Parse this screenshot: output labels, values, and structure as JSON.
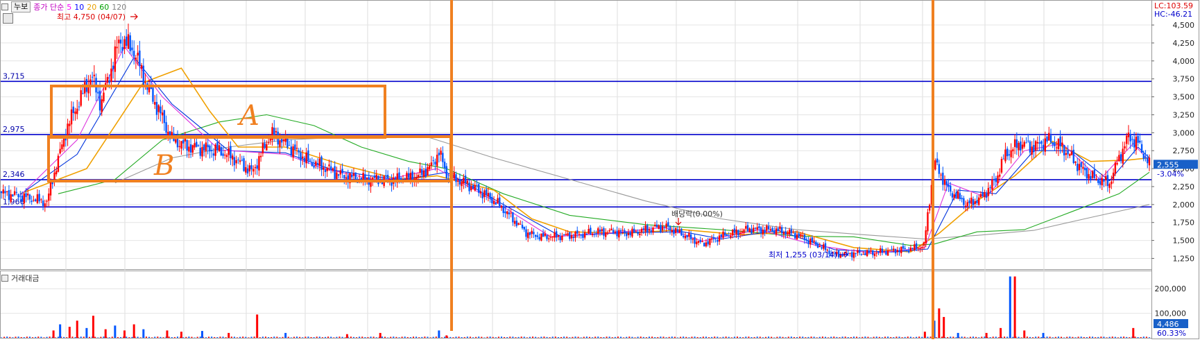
{
  "header": {
    "stock_name": "누보",
    "indicator_label": "종가 단순",
    "ma_periods": [
      {
        "label": "5",
        "color": "#ff00ff"
      },
      {
        "label": "10",
        "color": "#0000ff"
      },
      {
        "label": "20",
        "color": "#e8a000"
      },
      {
        "label": "60",
        "color": "#00a000"
      },
      {
        "label": "120",
        "color": "#808080"
      }
    ]
  },
  "right_info": {
    "lc": "LC:103.59",
    "hc": "HC:-46.21"
  },
  "price_axis": {
    "ticks": [
      "4,500",
      "4,250",
      "4,000",
      "3,750",
      "3,500",
      "3,250",
      "3,000",
      "2,750",
      "2,500",
      "2,250",
      "2,000",
      "1,750",
      "1,500",
      "1,250"
    ],
    "current_price": "2,555",
    "change_pct": "-3.04%"
  },
  "annotations": {
    "high": "최고 4,750 (04/07)",
    "low": "최저 1,255 (03/14)",
    "dividend": "배당락(0.00%)",
    "hand_a": "A",
    "hand_b": "B"
  },
  "levels": [
    {
      "label": "3,715",
      "price": 3715
    },
    {
      "label": "2,975",
      "price": 2975
    },
    {
      "label": "2,346",
      "price": 2346
    },
    {
      "label": "1,966",
      "price": 1966
    }
  ],
  "volume_panel": {
    "label": "거래대금",
    "ticks": [
      "200,000",
      "100,000"
    ],
    "current": "4,486",
    "pct": "60.33%"
  },
  "colors": {
    "up": "#ff0000",
    "down": "#0055ff",
    "level": "#0000cc",
    "marker": "#f08020"
  },
  "chart_data": {
    "type": "candlestick",
    "price_range": [
      1100,
      4800
    ],
    "volume_range": [
      0,
      260000
    ],
    "high": 4750,
    "low": 1255,
    "anchors": [
      [
        0,
        2160
      ],
      [
        20,
        2120
      ],
      [
        48,
        2030
      ],
      [
        55,
        2400
      ],
      [
        70,
        3100
      ],
      [
        95,
        3800
      ],
      [
        105,
        3400
      ],
      [
        125,
        4300
      ],
      [
        140,
        4150
      ],
      [
        155,
        3600
      ],
      [
        165,
        3350
      ],
      [
        180,
        2900
      ],
      [
        200,
        2800
      ],
      [
        215,
        2780
      ],
      [
        230,
        2750
      ],
      [
        245,
        2650
      ],
      [
        265,
        2450
      ],
      [
        285,
        3000
      ],
      [
        305,
        2800
      ],
      [
        325,
        2600
      ],
      [
        345,
        2500
      ],
      [
        360,
        2400
      ],
      [
        380,
        2350
      ],
      [
        400,
        2350
      ],
      [
        420,
        2350
      ],
      [
        440,
        2400
      ],
      [
        455,
        2550
      ],
      [
        462,
        2750
      ],
      [
        470,
        2400
      ],
      [
        490,
        2300
      ],
      [
        510,
        2150
      ],
      [
        525,
        2000
      ],
      [
        540,
        1800
      ],
      [
        555,
        1600
      ],
      [
        570,
        1550
      ],
      [
        590,
        1560
      ],
      [
        610,
        1580
      ],
      [
        630,
        1620
      ],
      [
        650,
        1620
      ],
      [
        665,
        1600
      ],
      [
        680,
        1650
      ],
      [
        700,
        1700
      ],
      [
        720,
        1580
      ],
      [
        740,
        1450
      ],
      [
        760,
        1560
      ],
      [
        790,
        1660
      ],
      [
        820,
        1640
      ],
      [
        840,
        1580
      ],
      [
        860,
        1450
      ],
      [
        880,
        1300
      ],
      [
        900,
        1320
      ],
      [
        920,
        1330
      ],
      [
        940,
        1360
      ],
      [
        960,
        1380
      ],
      [
        974,
        1430
      ],
      [
        985,
        2600
      ],
      [
        1000,
        2200
      ],
      [
        1020,
        2000
      ],
      [
        1035,
        2100
      ],
      [
        1050,
        2350
      ],
      [
        1060,
        2700
      ],
      [
        1075,
        2850
      ],
      [
        1090,
        2800
      ],
      [
        1105,
        2900
      ],
      [
        1120,
        2800
      ],
      [
        1140,
        2500
      ],
      [
        1155,
        2350
      ],
      [
        1170,
        2300
      ],
      [
        1180,
        2650
      ],
      [
        1190,
        2950
      ],
      [
        1200,
        2850
      ],
      [
        1212,
        2550
      ]
    ],
    "ma5": [
      [
        20,
        2130
      ],
      [
        80,
        2900
      ],
      [
        130,
        4200
      ],
      [
        170,
        3500
      ],
      [
        230,
        2760
      ],
      [
        300,
        2700
      ],
      [
        340,
        2500
      ],
      [
        400,
        2330
      ],
      [
        460,
        2500
      ],
      [
        520,
        2050
      ],
      [
        580,
        1550
      ],
      [
        650,
        1610
      ],
      [
        700,
        1680
      ],
      [
        740,
        1490
      ],
      [
        800,
        1650
      ],
      [
        860,
        1430
      ],
      [
        920,
        1320
      ],
      [
        975,
        1400
      ],
      [
        1000,
        2300
      ],
      [
        1040,
        2100
      ],
      [
        1080,
        2750
      ],
      [
        1120,
        2850
      ],
      [
        1160,
        2350
      ],
      [
        1195,
        2850
      ],
      [
        1212,
        2600
      ]
    ],
    "ma10": [
      [
        20,
        2140
      ],
      [
        80,
        2700
      ],
      [
        140,
        4050
      ],
      [
        180,
        3400
      ],
      [
        240,
        2750
      ],
      [
        300,
        2720
      ],
      [
        350,
        2480
      ],
      [
        420,
        2340
      ],
      [
        470,
        2450
      ],
      [
        530,
        2000
      ],
      [
        590,
        1560
      ],
      [
        660,
        1610
      ],
      [
        720,
        1620
      ],
      [
        760,
        1520
      ],
      [
        820,
        1640
      ],
      [
        880,
        1370
      ],
      [
        940,
        1340
      ],
      [
        978,
        1380
      ],
      [
        1010,
        2200
      ],
      [
        1050,
        2150
      ],
      [
        1090,
        2750
      ],
      [
        1130,
        2750
      ],
      [
        1170,
        2330
      ],
      [
        1200,
        2800
      ],
      [
        1212,
        2650
      ]
    ],
    "ma20": [
      [
        20,
        2150
      ],
      [
        90,
        2500
      ],
      [
        150,
        3700
      ],
      [
        190,
        3900
      ],
      [
        220,
        3300
      ],
      [
        250,
        2800
      ],
      [
        300,
        2800
      ],
      [
        360,
        2550
      ],
      [
        420,
        2350
      ],
      [
        460,
        2400
      ],
      [
        520,
        2200
      ],
      [
        560,
        1800
      ],
      [
        600,
        1620
      ],
      [
        660,
        1600
      ],
      [
        720,
        1650
      ],
      [
        780,
        1580
      ],
      [
        840,
        1620
      ],
      [
        900,
        1400
      ],
      [
        960,
        1340
      ],
      [
        990,
        1600
      ],
      [
        1030,
        2050
      ],
      [
        1070,
        2400
      ],
      [
        1110,
        2880
      ],
      [
        1150,
        2600
      ],
      [
        1190,
        2620
      ],
      [
        1212,
        2650
      ]
    ],
    "ma60": [
      [
        60,
        2150
      ],
      [
        120,
        2350
      ],
      [
        170,
        2900
      ],
      [
        230,
        3150
      ],
      [
        280,
        3250
      ],
      [
        330,
        3100
      ],
      [
        380,
        2800
      ],
      [
        430,
        2600
      ],
      [
        470,
        2500
      ],
      [
        530,
        2150
      ],
      [
        600,
        1850
      ],
      [
        680,
        1720
      ],
      [
        760,
        1650
      ],
      [
        840,
        1560
      ],
      [
        900,
        1550
      ],
      [
        960,
        1430
      ],
      [
        985,
        1450
      ],
      [
        1030,
        1620
      ],
      [
        1080,
        1650
      ],
      [
        1130,
        1900
      ],
      [
        1180,
        2150
      ],
      [
        1212,
        2450
      ]
    ],
    "ma120": [
      [
        120,
        2300
      ],
      [
        180,
        2650
      ],
      [
        240,
        2800
      ],
      [
        300,
        2900
      ],
      [
        380,
        2950
      ],
      [
        450,
        2940
      ],
      [
        520,
        2650
      ],
      [
        600,
        2350
      ],
      [
        680,
        2050
      ],
      [
        760,
        1800
      ],
      [
        840,
        1650
      ],
      [
        910,
        1580
      ],
      [
        975,
        1520
      ],
      [
        1030,
        1570
      ],
      [
        1090,
        1640
      ],
      [
        1150,
        1820
      ],
      [
        1212,
        2000
      ]
    ],
    "volume_spikes": [
      [
        55,
        30000
      ],
      [
        62,
        55000
      ],
      [
        72,
        45000
      ],
      [
        80,
        70000
      ],
      [
        90,
        40000
      ],
      [
        97,
        90000
      ],
      [
        110,
        35000
      ],
      [
        120,
        50000
      ],
      [
        130,
        30000
      ],
      [
        140,
        55000
      ],
      [
        150,
        35000
      ],
      [
        175,
        30000
      ],
      [
        190,
        25000
      ],
      [
        212,
        28000
      ],
      [
        240,
        20000
      ],
      [
        270,
        95000
      ],
      [
        300,
        20000
      ],
      [
        365,
        15000
      ],
      [
        400,
        20000
      ],
      [
        462,
        30000
      ],
      [
        470,
        10000
      ],
      [
        975,
        25000
      ],
      [
        985,
        70000
      ],
      [
        990,
        120000
      ],
      [
        995,
        85000
      ],
      [
        1010,
        20000
      ],
      [
        1040,
        20000
      ],
      [
        1055,
        40000
      ],
      [
        1065,
        250000
      ],
      [
        1070,
        250000
      ],
      [
        1080,
        30000
      ],
      [
        1100,
        20000
      ],
      [
        1195,
        40000
      ]
    ]
  }
}
